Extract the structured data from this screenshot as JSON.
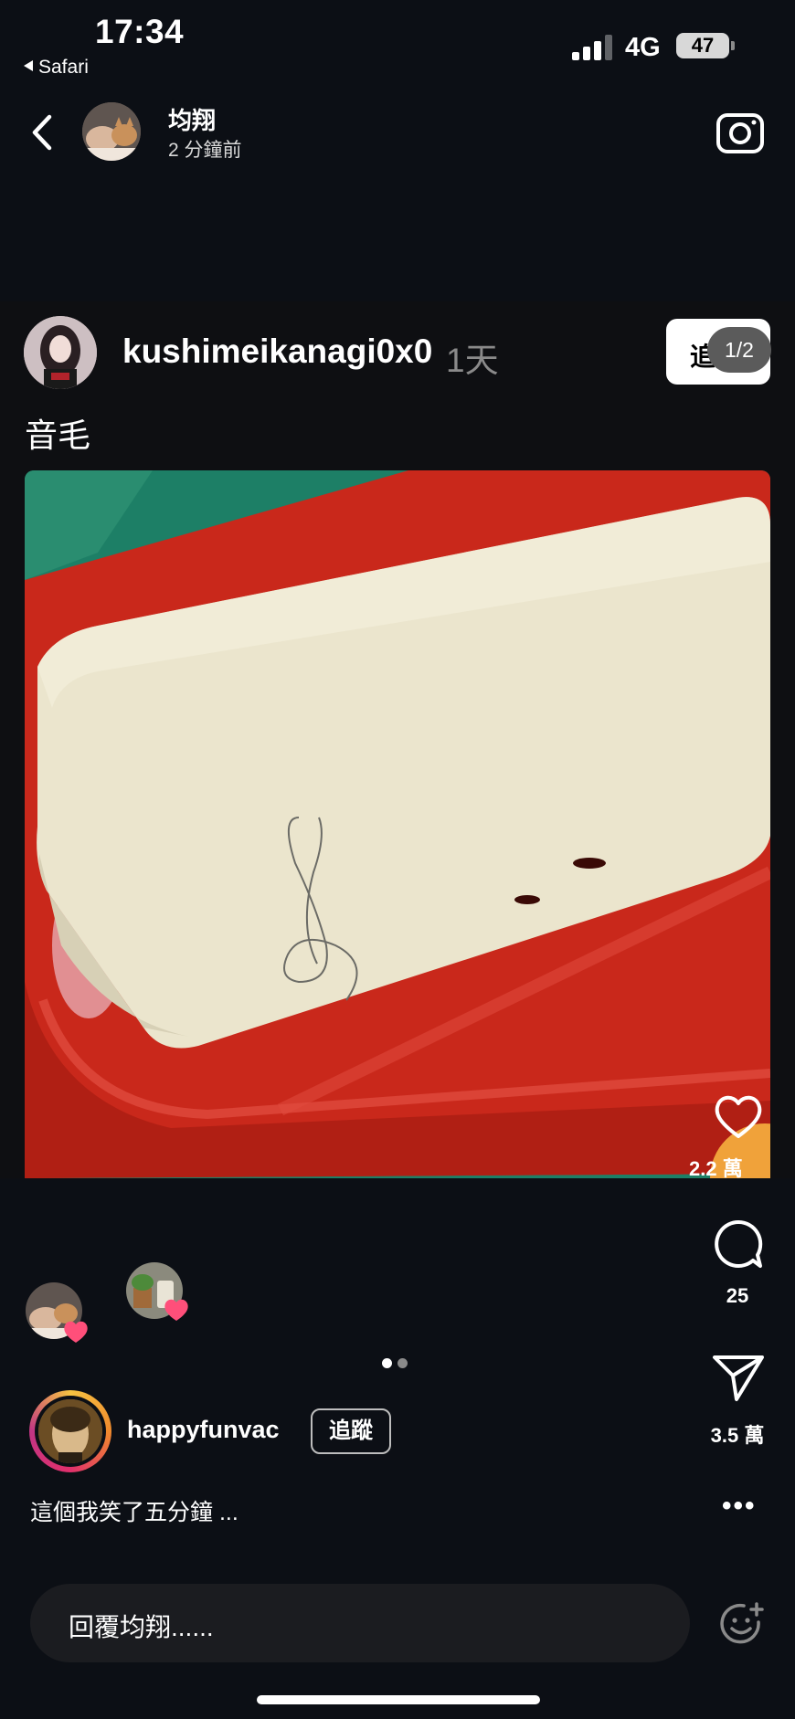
{
  "status_bar": {
    "time": "17:34",
    "back_app": "Safari",
    "network": "4G",
    "battery": "47"
  },
  "story_header": {
    "username": "均翔",
    "timestamp": "2 分鐘前",
    "back_icon": "chevron-left-icon",
    "camera_icon": "camera-icon"
  },
  "post": {
    "username": "kushimeikanagi0x0",
    "age": "1天",
    "follow_label": "追",
    "page_indicator": "1/2",
    "caption": "音毛"
  },
  "actions": {
    "like_count": "2.2 萬",
    "comment_count": "25",
    "share_count": "3.5 萬"
  },
  "shared_by": {
    "username": "happyfunvac",
    "follow_label": "追蹤",
    "caption": "這個我笑了五分鐘 ...",
    "more_label": "•••"
  },
  "reply": {
    "placeholder": "回覆均翔......"
  },
  "colors": {
    "background": "#0c0f15",
    "soap_dish": "#d72a1c",
    "soap": "#ece6cf",
    "towel": "#1f8a6a",
    "heart": "#ff4f7a"
  }
}
